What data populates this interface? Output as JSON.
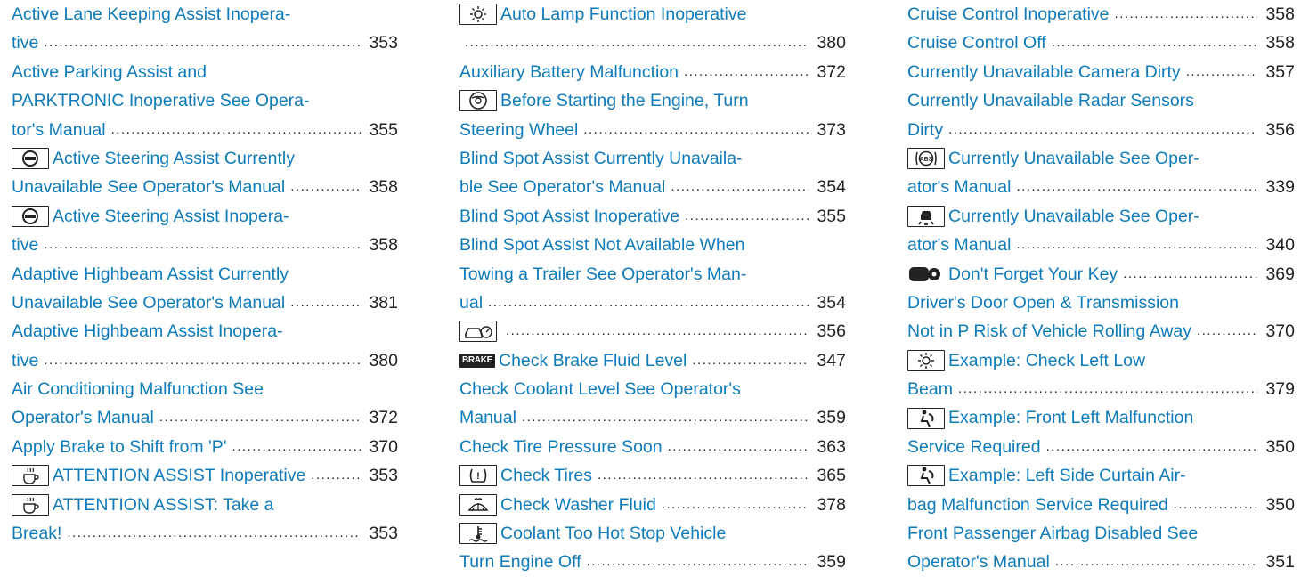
{
  "columns": [
    {
      "entries": [
        {
          "lines": [
            "Active Lane Keeping Assist Inopera-",
            "tive"
          ],
          "page": "353"
        },
        {
          "lines": [
            "Active Parking Assist and",
            "PARKTRONIC Inoperative See Opera-",
            "tor's Manual"
          ],
          "page": "355"
        },
        {
          "icon": "steering-assist-icon",
          "lines": [
            "Active Steering Assist Currently",
            "Unavailable See Operator's Manual"
          ],
          "page": "358"
        },
        {
          "icon": "steering-assist-icon",
          "lines": [
            "Active Steering Assist Inopera-",
            "tive"
          ],
          "page": "358"
        },
        {
          "lines": [
            "Adaptive Highbeam Assist Currently",
            "Unavailable See Operator's Manual"
          ],
          "page": "381"
        },
        {
          "lines": [
            "Adaptive Highbeam Assist Inopera-",
            "tive"
          ],
          "page": "380"
        },
        {
          "lines": [
            "Air Conditioning Malfunction See",
            "Operator's Manual"
          ],
          "page": "372"
        },
        {
          "lines": [
            "Apply Brake to Shift from 'P'"
          ],
          "page": "370"
        },
        {
          "icon": "coffee-cup-icon",
          "lines": [
            "ATTENTION ASSIST Inoperative"
          ],
          "page": "353"
        },
        {
          "icon": "coffee-cup-icon",
          "lines": [
            "ATTENTION ASSIST: Take a",
            "Break!"
          ],
          "page": "353"
        }
      ]
    },
    {
      "entries": [
        {
          "icon": "lamp-icon",
          "lines": [
            "Auto Lamp Function Inoperative",
            ""
          ],
          "page": "380"
        },
        {
          "lines": [
            "Auxiliary Battery Malfunction"
          ],
          "page": "372"
        },
        {
          "icon": "steering-wheel-icon",
          "lines": [
            "Before Starting the Engine, Turn",
            "Steering Wheel"
          ],
          "page": "373"
        },
        {
          "lines": [
            "Blind Spot Assist Currently Unavaila-",
            "ble See Operator's Manual"
          ],
          "page": "354"
        },
        {
          "lines": [
            "Blind Spot Assist Inoperative"
          ],
          "page": "355"
        },
        {
          "lines": [
            "Blind Spot Assist Not Available When",
            "Towing a Trailer See Operator's Man-",
            "ual"
          ],
          "page": "354"
        },
        {
          "icon": "car-speed-icon",
          "lines": [
            ""
          ],
          "page": "356"
        },
        {
          "icon": "brake-icon",
          "icon_text": "BRAKE",
          "lines": [
            "Check Brake Fluid Level"
          ],
          "page": "347"
        },
        {
          "lines": [
            "Check Coolant Level See Operator's",
            "Manual"
          ],
          "page": "359"
        },
        {
          "lines": [
            "Check Tire Pressure Soon"
          ],
          "page": "363"
        },
        {
          "icon": "tire-pressure-icon",
          "lines": [
            "Check Tires"
          ],
          "page": "365"
        },
        {
          "icon": "washer-fluid-icon",
          "lines": [
            "Check Washer Fluid"
          ],
          "page": "378"
        },
        {
          "icon": "coolant-temp-icon",
          "lines": [
            "Coolant Too Hot Stop Vehicle",
            "Turn Engine Off"
          ],
          "page": "359"
        }
      ]
    },
    {
      "entries": [
        {
          "lines": [
            "Cruise Control Inoperative"
          ],
          "page": "358"
        },
        {
          "lines": [
            "Cruise Control Off"
          ],
          "page": "358"
        },
        {
          "lines": [
            "Currently Unavailable Camera Dirty"
          ],
          "page": "357"
        },
        {
          "lines": [
            "Currently Unavailable Radar Sensors",
            "Dirty"
          ],
          "page": "356"
        },
        {
          "icon": "abs-icon",
          "lines": [
            "Currently Unavailable See Oper-",
            "ator's Manual"
          ],
          "page": "339"
        },
        {
          "icon": "lane-car-icon",
          "lines": [
            "Currently Unavailable See Oper-",
            "ator's Manual"
          ],
          "page": "340"
        },
        {
          "icon": "key-icon",
          "lines": [
            "Don't Forget Your Key"
          ],
          "page": "369"
        },
        {
          "lines": [
            "Driver's Door Open & Transmission",
            "Not in P Risk of Vehicle Rolling Away"
          ],
          "page": "370"
        },
        {
          "icon": "lamp-icon",
          "lines": [
            "Example: Check Left Low",
            "Beam"
          ],
          "page": "379"
        },
        {
          "icon": "airbag-icon",
          "lines": [
            "Example: Front Left Malfunction",
            "Service Required"
          ],
          "page": "350"
        },
        {
          "icon": "airbag-icon",
          "lines": [
            "Example: Left Side Curtain Air-",
            "bag Malfunction Service Required"
          ],
          "page": "350"
        },
        {
          "lines": [
            "Front Passenger Airbag Disabled See",
            "Operator's Manual"
          ],
          "page": "351"
        }
      ]
    }
  ]
}
